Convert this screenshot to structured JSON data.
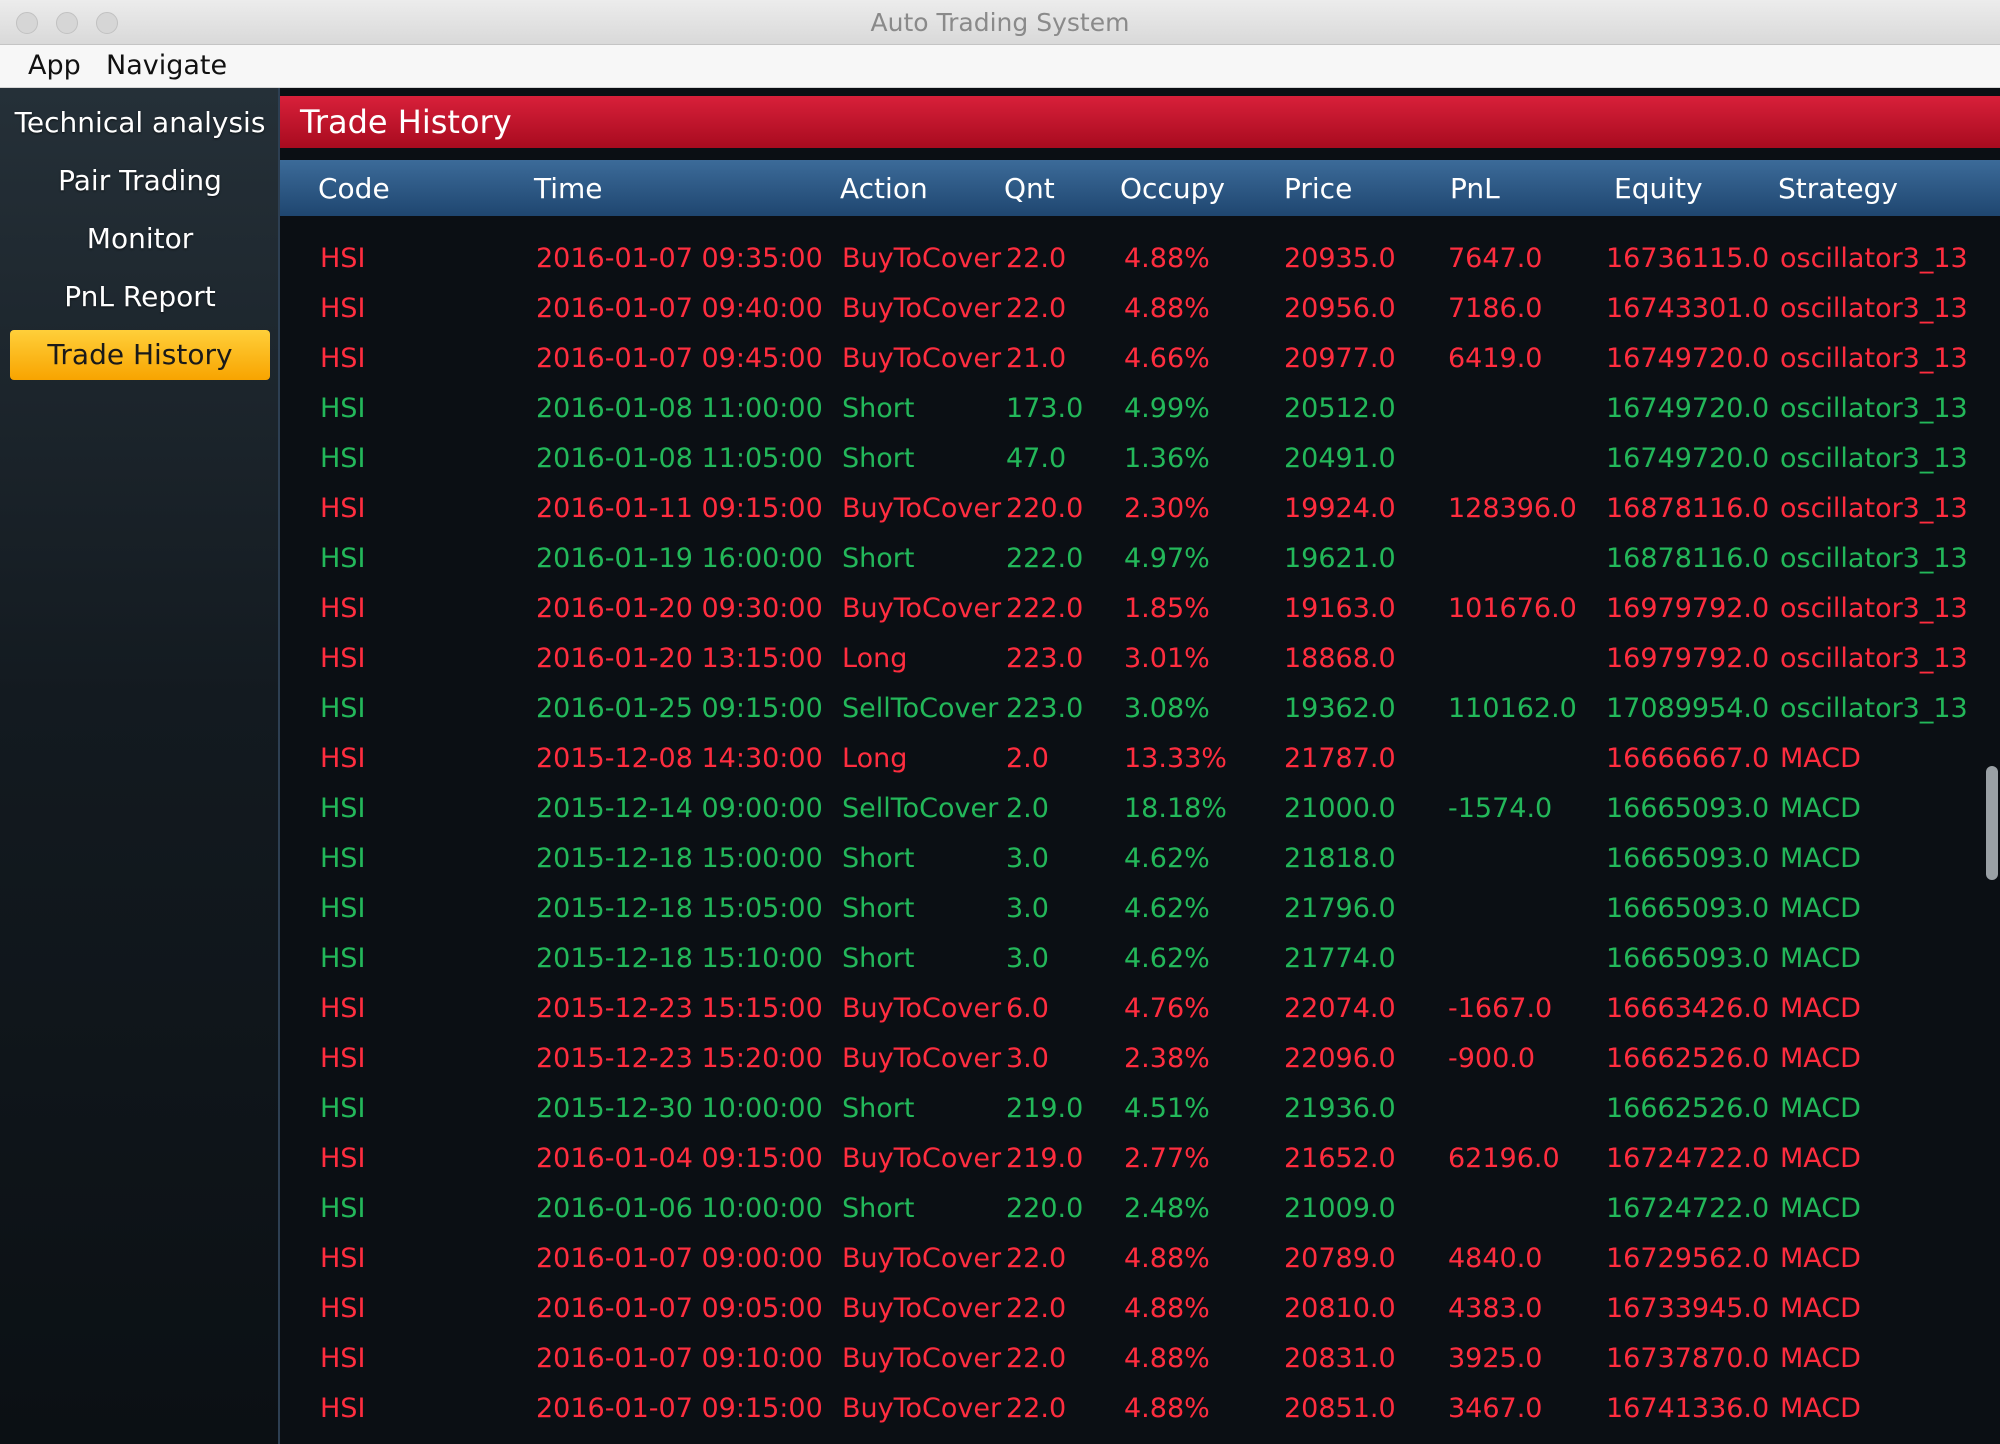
{
  "window": {
    "title": "Auto Trading System"
  },
  "menu": {
    "items": [
      "App",
      "Navigate"
    ]
  },
  "sidebar": {
    "items": [
      {
        "label": "Technical analysis",
        "active": false
      },
      {
        "label": "Pair Trading",
        "active": false
      },
      {
        "label": "Monitor",
        "active": false
      },
      {
        "label": "PnL Report",
        "active": false
      },
      {
        "label": "Trade History",
        "active": true
      }
    ]
  },
  "header": {
    "title": "Trade History"
  },
  "colors": {
    "buy": "#ff2d3f",
    "sell": "#23b85a",
    "accent": "#f8a400",
    "header": "#c4142b"
  },
  "table": {
    "columns": [
      "Code",
      "Time",
      "Action",
      "Qnt",
      "Occupy",
      "Price",
      "PnL",
      "Equity",
      "Strategy"
    ],
    "rows": [
      {
        "color": "red",
        "cells": [
          "HSI",
          "2016-01-07 09:35:00",
          "BuyToCover",
          "22.0",
          "4.88%",
          "20935.0",
          "7647.0",
          "16736115.0",
          "oscillator3_13"
        ]
      },
      {
        "color": "red",
        "cells": [
          "HSI",
          "2016-01-07 09:40:00",
          "BuyToCover",
          "22.0",
          "4.88%",
          "20956.0",
          "7186.0",
          "16743301.0",
          "oscillator3_13"
        ]
      },
      {
        "color": "red",
        "cells": [
          "HSI",
          "2016-01-07 09:45:00",
          "BuyToCover",
          "21.0",
          "4.66%",
          "20977.0",
          "6419.0",
          "16749720.0",
          "oscillator3_13"
        ]
      },
      {
        "color": "green",
        "cells": [
          "HSI",
          "2016-01-08 11:00:00",
          "Short",
          "173.0",
          "4.99%",
          "20512.0",
          "",
          "16749720.0",
          "oscillator3_13"
        ]
      },
      {
        "color": "green",
        "cells": [
          "HSI",
          "2016-01-08 11:05:00",
          "Short",
          "47.0",
          "1.36%",
          "20491.0",
          "",
          "16749720.0",
          "oscillator3_13"
        ]
      },
      {
        "color": "red",
        "cells": [
          "HSI",
          "2016-01-11 09:15:00",
          "BuyToCover",
          "220.0",
          "2.30%",
          "19924.0",
          "128396.0",
          "16878116.0",
          "oscillator3_13"
        ]
      },
      {
        "color": "green",
        "cells": [
          "HSI",
          "2016-01-19 16:00:00",
          "Short",
          "222.0",
          "4.97%",
          "19621.0",
          "",
          "16878116.0",
          "oscillator3_13"
        ]
      },
      {
        "color": "red",
        "cells": [
          "HSI",
          "2016-01-20 09:30:00",
          "BuyToCover",
          "222.0",
          "1.85%",
          "19163.0",
          "101676.0",
          "16979792.0",
          "oscillator3_13"
        ]
      },
      {
        "color": "red",
        "cells": [
          "HSI",
          "2016-01-20 13:15:00",
          "Long",
          "223.0",
          "3.01%",
          "18868.0",
          "",
          "16979792.0",
          "oscillator3_13"
        ]
      },
      {
        "color": "green",
        "cells": [
          "HSI",
          "2016-01-25 09:15:00",
          "SellToCover",
          "223.0",
          "3.08%",
          "19362.0",
          "110162.0",
          "17089954.0",
          "oscillator3_13"
        ]
      },
      {
        "color": "red",
        "cells": [
          "HSI",
          "2015-12-08 14:30:00",
          "Long",
          "2.0",
          "13.33%",
          "21787.0",
          "",
          "16666667.0",
          "MACD"
        ]
      },
      {
        "color": "green",
        "cells": [
          "HSI",
          "2015-12-14 09:00:00",
          "SellToCover",
          "2.0",
          "18.18%",
          "21000.0",
          "-1574.0",
          "16665093.0",
          "MACD"
        ]
      },
      {
        "color": "green",
        "cells": [
          "HSI",
          "2015-12-18 15:00:00",
          "Short",
          "3.0",
          "4.62%",
          "21818.0",
          "",
          "16665093.0",
          "MACD"
        ]
      },
      {
        "color": "green",
        "cells": [
          "HSI",
          "2015-12-18 15:05:00",
          "Short",
          "3.0",
          "4.62%",
          "21796.0",
          "",
          "16665093.0",
          "MACD"
        ]
      },
      {
        "color": "green",
        "cells": [
          "HSI",
          "2015-12-18 15:10:00",
          "Short",
          "3.0",
          "4.62%",
          "21774.0",
          "",
          "16665093.0",
          "MACD"
        ]
      },
      {
        "color": "red",
        "cells": [
          "HSI",
          "2015-12-23 15:15:00",
          "BuyToCover",
          "6.0",
          "4.76%",
          "22074.0",
          "-1667.0",
          "16663426.0",
          "MACD"
        ]
      },
      {
        "color": "red",
        "cells": [
          "HSI",
          "2015-12-23 15:20:00",
          "BuyToCover",
          "3.0",
          "2.38%",
          "22096.0",
          "-900.0",
          "16662526.0",
          "MACD"
        ]
      },
      {
        "color": "green",
        "cells": [
          "HSI",
          "2015-12-30 10:00:00",
          "Short",
          "219.0",
          "4.51%",
          "21936.0",
          "",
          "16662526.0",
          "MACD"
        ]
      },
      {
        "color": "red",
        "cells": [
          "HSI",
          "2016-01-04 09:15:00",
          "BuyToCover",
          "219.0",
          "2.77%",
          "21652.0",
          "62196.0",
          "16724722.0",
          "MACD"
        ]
      },
      {
        "color": "green",
        "cells": [
          "HSI",
          "2016-01-06 10:00:00",
          "Short",
          "220.0",
          "2.48%",
          "21009.0",
          "",
          "16724722.0",
          "MACD"
        ]
      },
      {
        "color": "red",
        "cells": [
          "HSI",
          "2016-01-07 09:00:00",
          "BuyToCover",
          "22.0",
          "4.88%",
          "20789.0",
          "4840.0",
          "16729562.0",
          "MACD"
        ]
      },
      {
        "color": "red",
        "cells": [
          "HSI",
          "2016-01-07 09:05:00",
          "BuyToCover",
          "22.0",
          "4.88%",
          "20810.0",
          "4383.0",
          "16733945.0",
          "MACD"
        ]
      },
      {
        "color": "red",
        "cells": [
          "HSI",
          "2016-01-07 09:10:00",
          "BuyToCover",
          "22.0",
          "4.88%",
          "20831.0",
          "3925.0",
          "16737870.0",
          "MACD"
        ]
      },
      {
        "color": "red",
        "cells": [
          "HSI",
          "2016-01-07 09:15:00",
          "BuyToCover",
          "22.0",
          "4.88%",
          "20851.0",
          "3467.0",
          "16741336.0",
          "MACD"
        ]
      }
    ]
  }
}
